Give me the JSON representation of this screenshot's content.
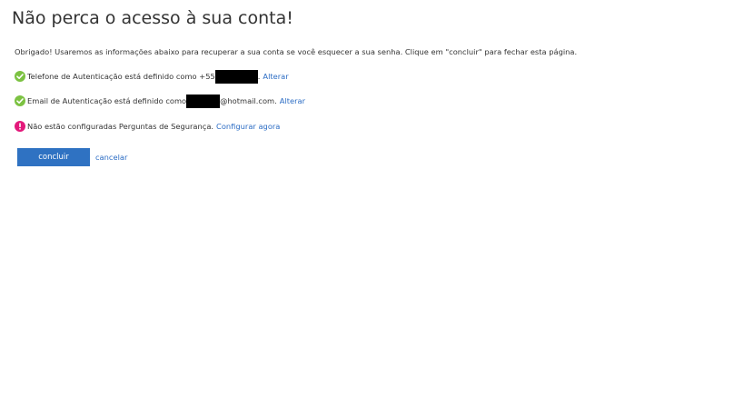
{
  "page": {
    "title": "Não perca o acesso à sua conta!",
    "intro": "Obrigado! Usaremos as informações abaixo para recuperar a sua conta se você esquecer a sua senha. Clique em \"concluir\" para fechar esta página."
  },
  "items": {
    "phone": {
      "status": "ok",
      "icon": "check-circle-icon",
      "text_before": "Telefone de Autenticação está definido como +55",
      "text_after": ".",
      "link_label": "Alterar"
    },
    "email": {
      "status": "ok",
      "icon": "check-circle-icon",
      "text_before": "Email de Autenticação está definido como",
      "text_after": "@hotmail.com.",
      "link_label": "Alterar"
    },
    "security_questions": {
      "status": "warning",
      "icon": "exclamation-circle-icon",
      "text": "Não estão configuradas Perguntas de Segurança.",
      "link_label": "Configurar agora"
    }
  },
  "actions": {
    "primary_label": "concluir",
    "cancel_label": "cancelar"
  },
  "colors": {
    "ok_green": "#7cc242",
    "warning_pink": "#e3197b",
    "primary_blue": "#2f72c2",
    "link_blue": "#2b6cc4",
    "redaction": "#000000"
  }
}
